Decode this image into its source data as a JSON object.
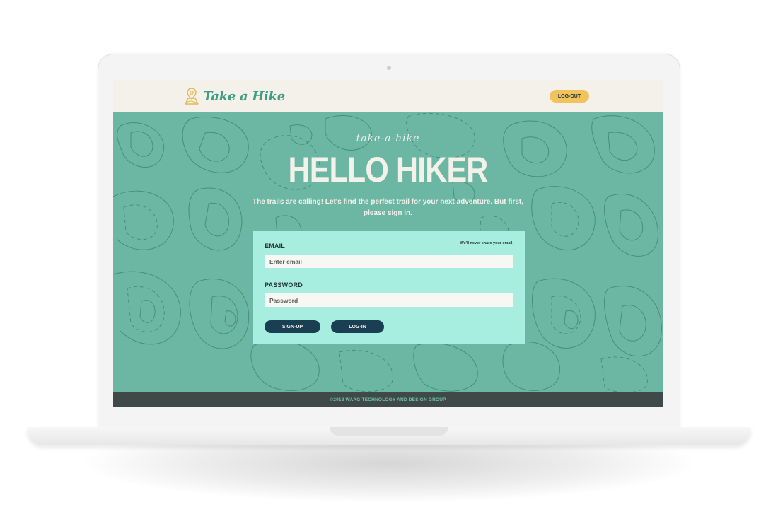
{
  "colors": {
    "accent_yellow": "#f1c35d",
    "hero_green": "#6cb7a3",
    "card_mint": "#a7eee0",
    "navy_button": "#1b3f52",
    "cream": "#f4f1ea",
    "footer_dark": "#3f4a48",
    "footer_text": "#6cc3a8"
  },
  "header": {
    "logo_icon": "map-pin-icon",
    "logo_text": "Take a Hike",
    "logout_label": "LOG-OUT"
  },
  "hero": {
    "script_title": "take-a-hike",
    "headline": "HELLO HIKER",
    "subtitle": "The trails are calling! Let's find the perfect trail for your next adventure. But first, please sign in."
  },
  "login": {
    "email_label": "EMAIL",
    "privacy_note": "We'll never share your email.",
    "email_placeholder": "Enter email",
    "password_label": "PASSWORD",
    "password_placeholder": "Password",
    "signup_label": "SIGN-UP",
    "login_label": "LOG-IN"
  },
  "footer": {
    "text": "©2018 WAAG TECHNOLOGY AND DESIGN GROUP"
  }
}
